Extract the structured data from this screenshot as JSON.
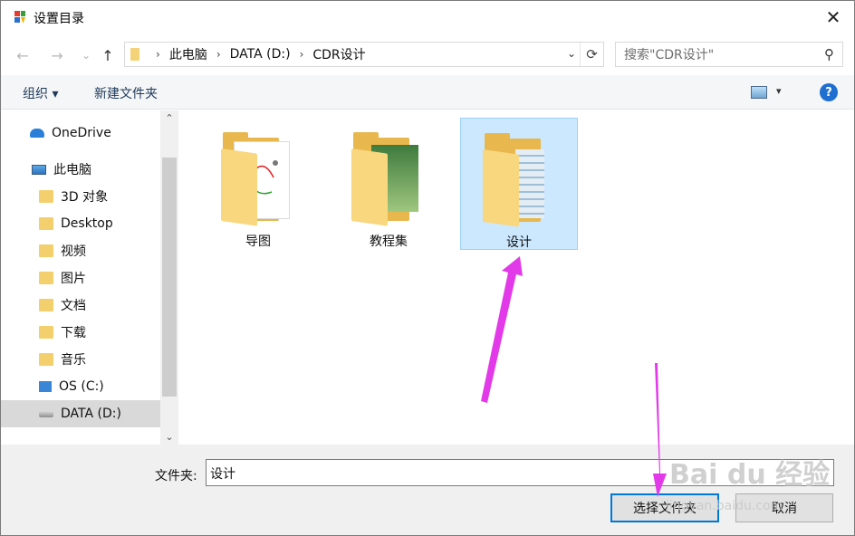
{
  "window": {
    "title": "设置目录",
    "close_glyph": "✕"
  },
  "navbar": {
    "back_glyph": "←",
    "forward_glyph": "→",
    "recent_glyph": "⌄",
    "up_glyph": "↑",
    "breadcrumb": [
      "此电脑",
      "DATA (D:)",
      "CDR设计"
    ],
    "breadcrumb_sep": "›",
    "dropdown_glyph": "⌄",
    "refresh_glyph": "⟳",
    "search_placeholder": "搜索\"CDR设计\"",
    "search_glyph": "⚲"
  },
  "commandbar": {
    "organize": "组织 ▾",
    "new_folder": "新建文件夹",
    "view_dropdown_glyph": "▾",
    "help_glyph": "?"
  },
  "sidebar": {
    "items": [
      {
        "label": "OneDrive",
        "icon": "cloud-icon"
      },
      {
        "label": "此电脑",
        "icon": "computer-icon"
      },
      {
        "label": "3D 对象",
        "icon": "folder-icon"
      },
      {
        "label": "Desktop",
        "icon": "folder-icon"
      },
      {
        "label": "视频",
        "icon": "folder-icon"
      },
      {
        "label": "图片",
        "icon": "folder-icon"
      },
      {
        "label": "文档",
        "icon": "folder-icon"
      },
      {
        "label": "下载",
        "icon": "folder-icon"
      },
      {
        "label": "音乐",
        "icon": "folder-icon"
      },
      {
        "label": "OS (C:)",
        "icon": "drive-icon"
      },
      {
        "label": "DATA (D:)",
        "icon": "drive-icon"
      }
    ],
    "scroll_up_glyph": "⌃",
    "scroll_down_glyph": "⌄"
  },
  "content": {
    "folders": [
      {
        "label": "导图",
        "selected": false
      },
      {
        "label": "教程集",
        "selected": false
      },
      {
        "label": "设计",
        "selected": true
      }
    ]
  },
  "footer": {
    "folder_label": "文件夹:",
    "folder_value": "设计",
    "select_button": "选择文件夹",
    "cancel_button": "取消"
  },
  "watermark": {
    "logo": "Bai du 经验",
    "url": "jingyan.baidu.com"
  },
  "colors": {
    "accent": "#0078d7",
    "selection_bg": "#cce8ff",
    "annotation_arrow": "#e23ae8",
    "folder": "#f4cf6d"
  }
}
